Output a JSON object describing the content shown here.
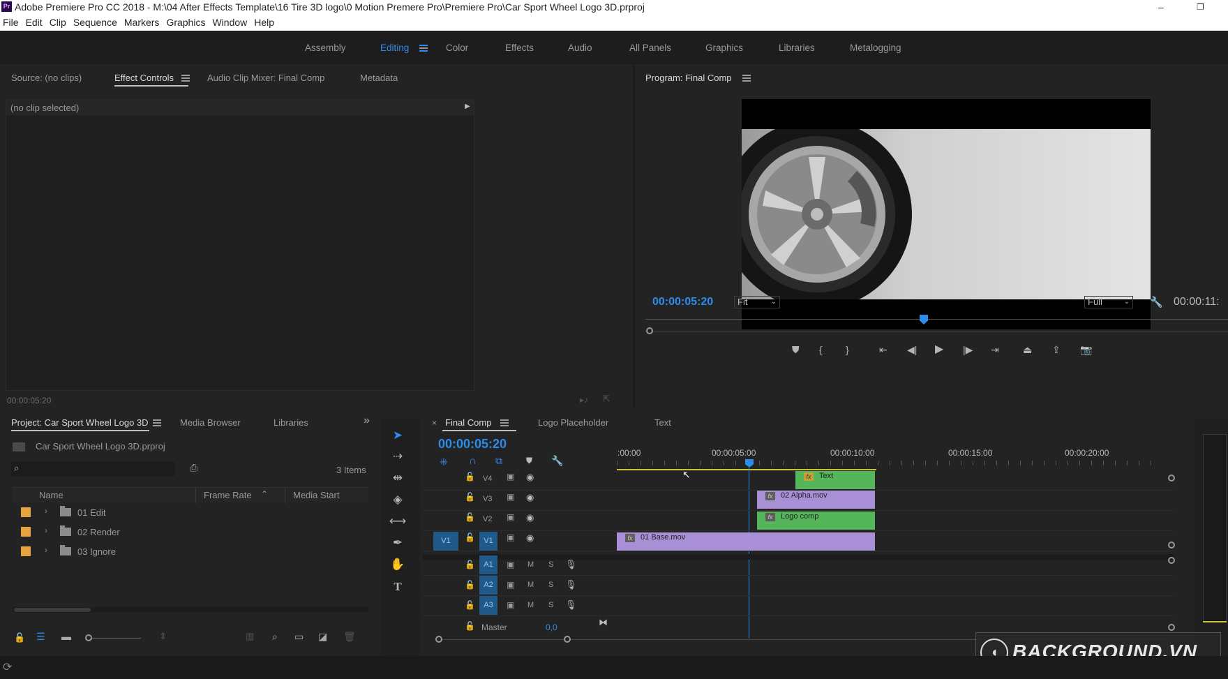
{
  "titlebar": {
    "title": "Adobe Premiere Pro CC 2018 - M:\\04 After Effects Template\\16 Tire 3D logo\\0 Motion Premere Pro\\Premiere Pro\\Car Sport Wheel Logo 3D.prproj",
    "minimize": "–",
    "restore": "❐"
  },
  "menu": [
    "File",
    "Edit",
    "Clip",
    "Sequence",
    "Markers",
    "Graphics",
    "Window",
    "Help"
  ],
  "workspaces": [
    "Assembly",
    "Editing",
    "Color",
    "Effects",
    "Audio",
    "All Panels",
    "Graphics",
    "Libraries",
    "Metalogging"
  ],
  "source_panel": {
    "tabs": [
      "Source: (no clips)",
      "Effect Controls",
      "Audio Clip Mixer: Final Comp",
      "Metadata"
    ],
    "no_clip": "(no clip selected)",
    "timecode": "00:00:05:20"
  },
  "program": {
    "title": "Program: Final Comp",
    "timecode": "00:00:05:20",
    "fit": "Fit",
    "quality": "Full",
    "duration": "00:00:11:"
  },
  "project": {
    "tabs": [
      "Project: Car Sport Wheel Logo 3D",
      "Media Browser",
      "Libraries"
    ],
    "file": "Car Sport Wheel Logo 3D.prproj",
    "items_count": "3 Items",
    "search_placeholder": "",
    "columns": [
      "Name",
      "Frame Rate",
      "Media Start"
    ],
    "rows": [
      {
        "name": "01 Edit",
        "color": "#e8a53d"
      },
      {
        "name": "02 Render",
        "color": "#e8a53d"
      },
      {
        "name": "03 Ignore",
        "color": "#e8a53d"
      }
    ]
  },
  "timeline": {
    "tabs": [
      "Final Comp",
      "Logo Placeholder",
      "Text"
    ],
    "close": "×",
    "timecode": "00:00:05:20",
    "ruler": [
      ":00:00",
      "00:00:05:00",
      "00:00:10:00",
      "00:00:15:00",
      "00:00:20:00"
    ],
    "video_tracks": [
      "V4",
      "V3",
      "V2",
      "V1"
    ],
    "source_v": "V1",
    "audio_tracks": [
      "A1",
      "A2",
      "A3"
    ],
    "audio_m": "M",
    "audio_s": "S",
    "master_label": "Master",
    "master_value": "0,0",
    "clips": [
      {
        "name": "Text",
        "track": "V4",
        "color": "#55b55a"
      },
      {
        "name": "02 Alpha.mov",
        "track": "V3",
        "color": "#a98fd6"
      },
      {
        "name": "Logo comp",
        "track": "V2",
        "color": "#55b55a"
      },
      {
        "name": "01 Base.mov",
        "track": "V1",
        "color": "#a98fd6"
      }
    ]
  },
  "watermark": "BACKGROUND.VN",
  "colors": {
    "accent": "#2d8ceb",
    "panel_bg": "#232323",
    "frame_bg": "#1d1d1d"
  }
}
